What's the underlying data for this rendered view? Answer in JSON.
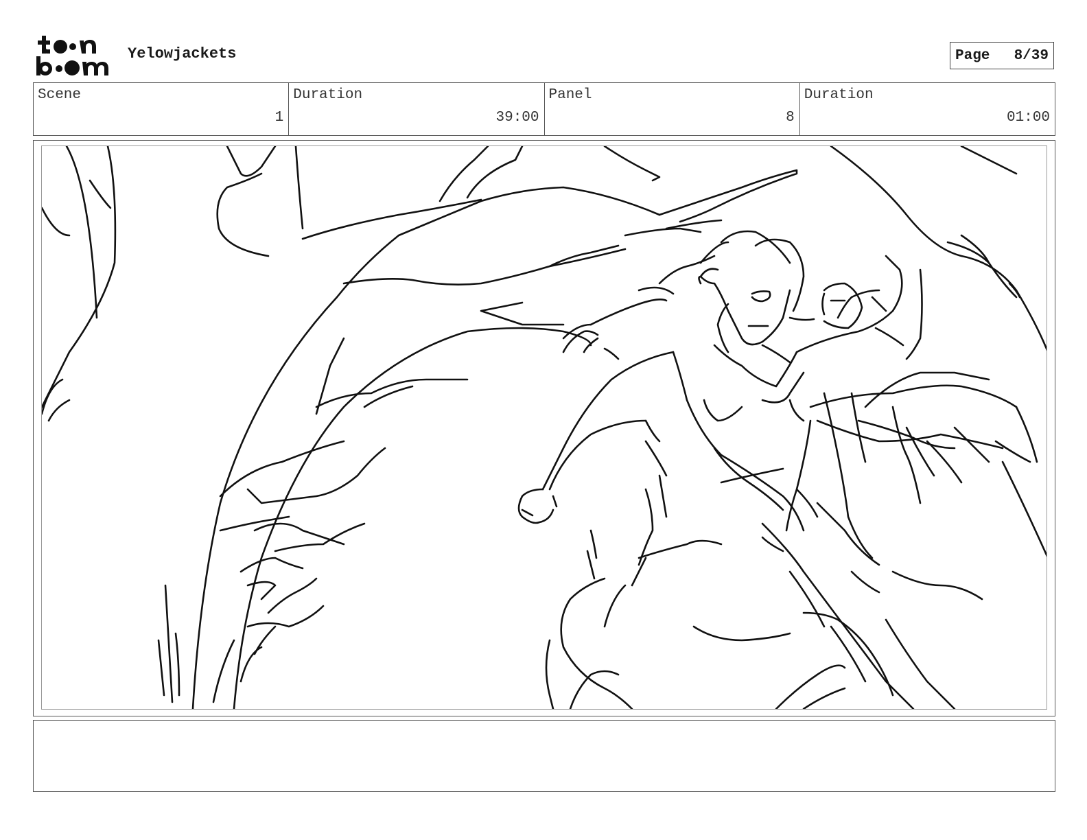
{
  "header": {
    "logo_text": "toon boom",
    "project_title": "Yelowjackets",
    "page_label": "Page",
    "page_value": "8/39"
  },
  "info": {
    "scene_label": "Scene",
    "scene_value": "1",
    "scene_duration_label": "Duration",
    "scene_duration_value": "39:00",
    "panel_label": "Panel",
    "panel_value": "8",
    "panel_duration_label": "Duration",
    "panel_duration_value": "01:00"
  },
  "panel": {
    "description": ""
  },
  "notes": {
    "text": ""
  }
}
